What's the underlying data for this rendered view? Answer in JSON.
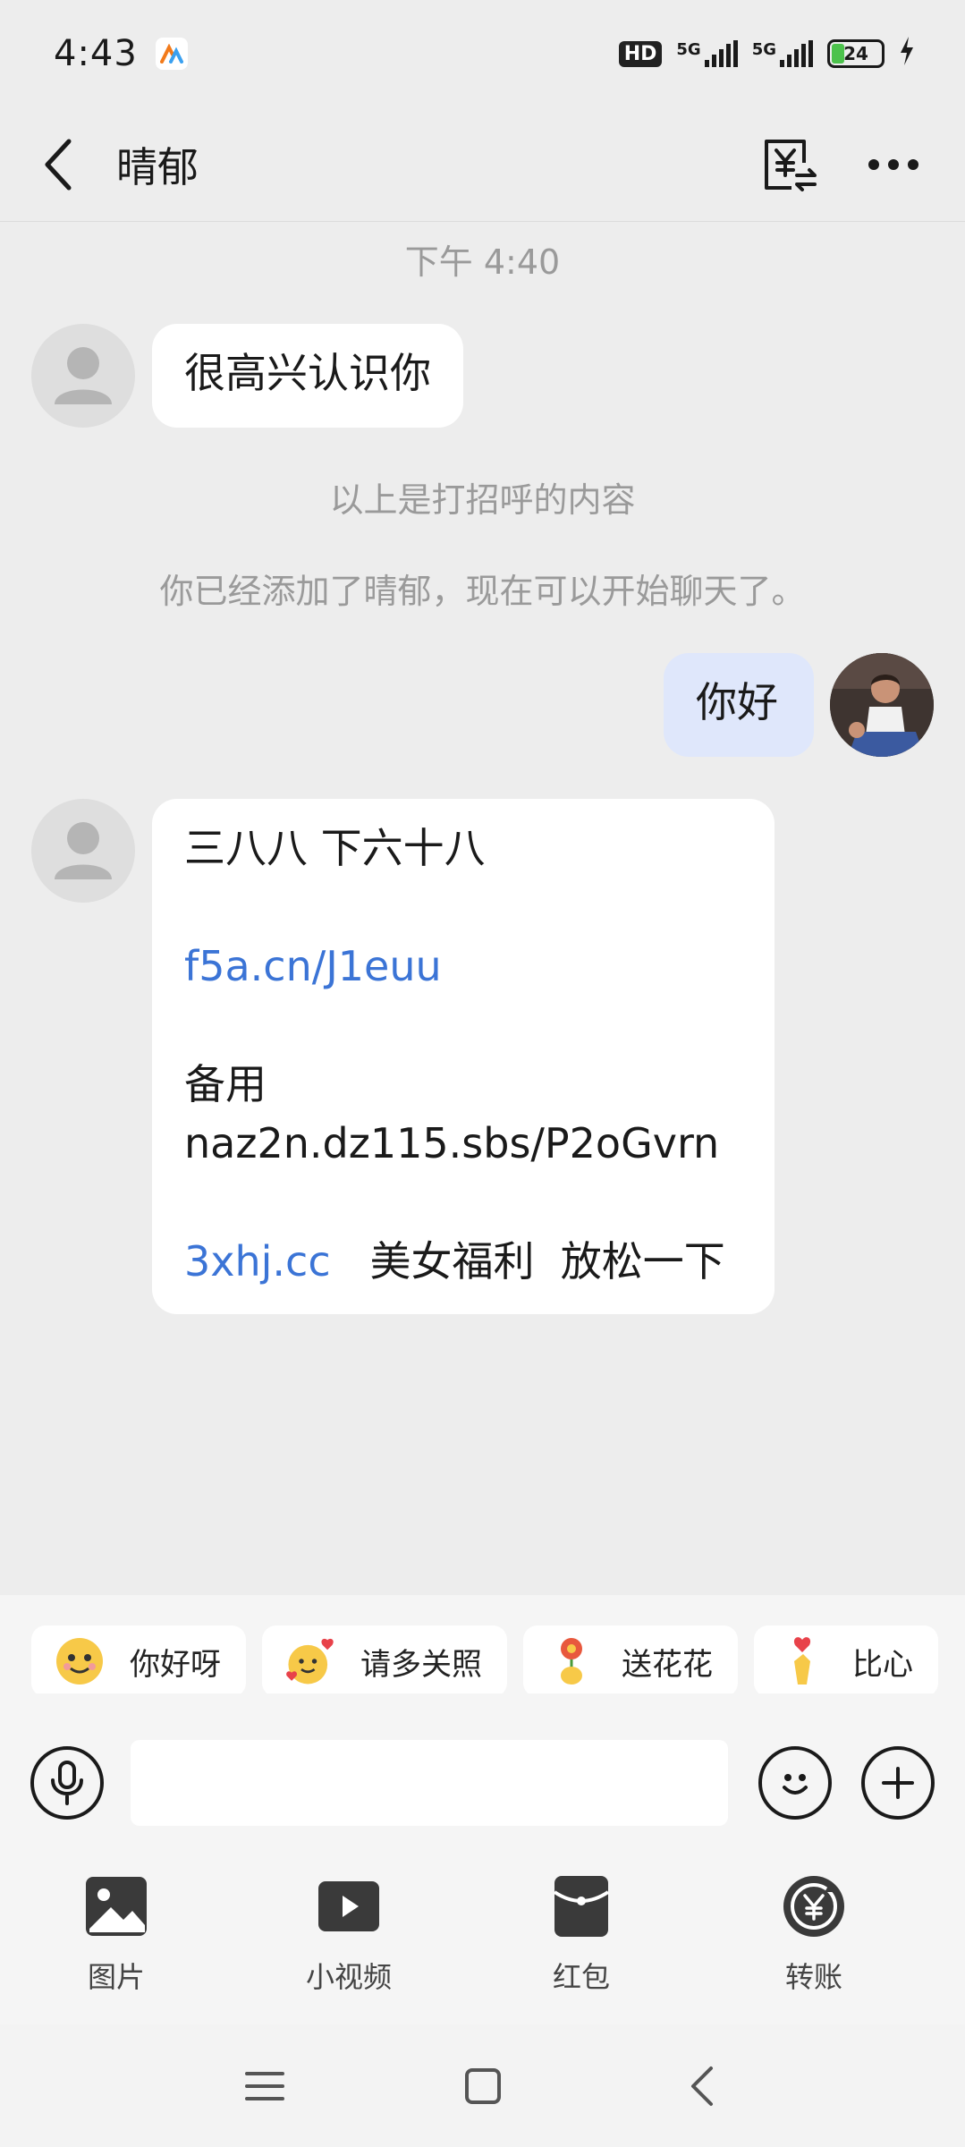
{
  "status_bar": {
    "time": "4:43",
    "hd_label": "HD",
    "network_1": "5G",
    "network_2": "5G",
    "battery": "24",
    "icons": [
      "app-notification-icon",
      "hd-voice-icon",
      "signal-icon",
      "battery-icon",
      "charging-icon"
    ]
  },
  "header": {
    "title": "晴郁",
    "icons": [
      "back-icon",
      "transfer-icon",
      "more-icon"
    ]
  },
  "chat": {
    "timestamp": "下午 4:40",
    "greeting_message": "很高兴认识你",
    "system_notice_1": "以上是打招呼的内容",
    "system_notice_2": "你已经添加了晴郁，现在可以开始聊天了。",
    "self_message": "你好",
    "spam_message": {
      "line1": "三八八 下六十八",
      "link1": "f5a.cn/J1euu",
      "line3": "备用",
      "line4": "naz2n.dz115.sbs/P2oGvrn",
      "link2": "3xhj.cc",
      "line5_rest": "美女福利  放松一下"
    }
  },
  "quick_replies": [
    {
      "label": "你好呀",
      "icon": "hello-emoji-icon"
    },
    {
      "label": "请多关照",
      "icon": "hug-emoji-icon"
    },
    {
      "label": "送花花",
      "icon": "flower-emoji-icon"
    },
    {
      "label": "比心",
      "icon": "finger-heart-icon"
    }
  ],
  "input": {
    "placeholder": "",
    "icons": [
      "voice-icon",
      "emoji-icon",
      "plus-icon"
    ]
  },
  "tools": [
    {
      "label": "图片",
      "icon": "image-icon"
    },
    {
      "label": "小视频",
      "icon": "video-icon"
    },
    {
      "label": "红包",
      "icon": "red-packet-icon"
    },
    {
      "label": "转账",
      "icon": "transfer-money-icon"
    }
  ],
  "colors": {
    "link": "#3b74d6",
    "self_bubble": "#dfe7fb",
    "background": "#ededed"
  }
}
